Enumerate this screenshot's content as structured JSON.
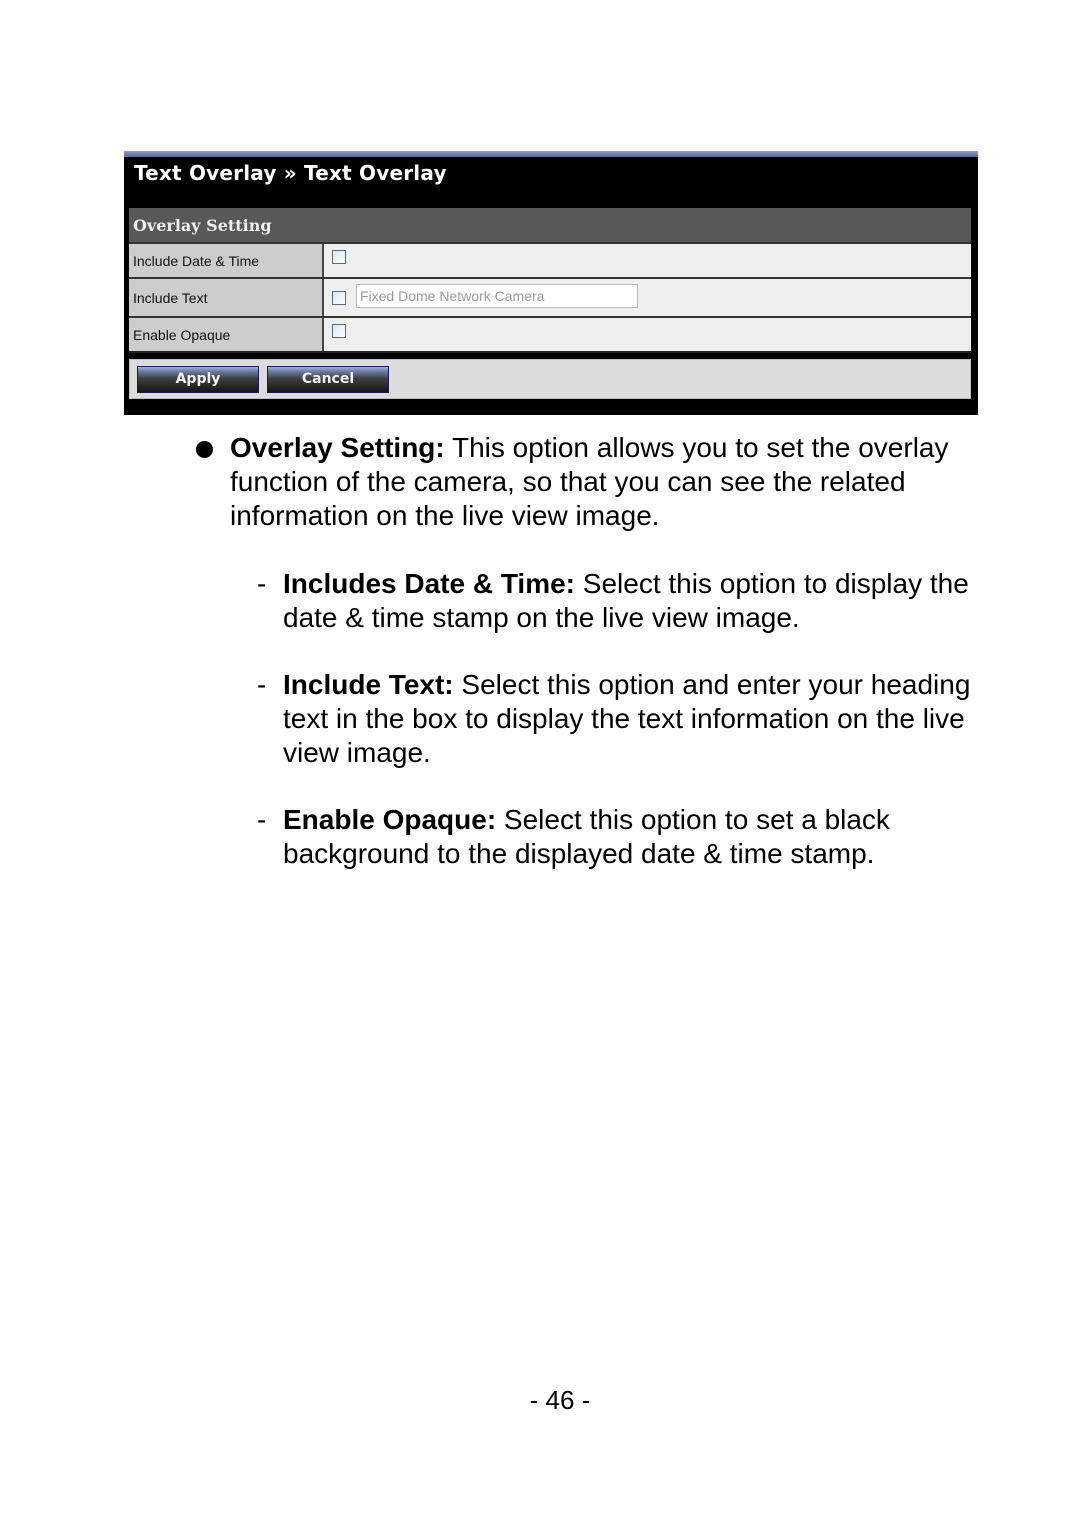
{
  "panel": {
    "title": "Text Overlay » Text Overlay",
    "section_title": "Overlay Setting",
    "rows": [
      {
        "label": "Include Date & Time",
        "checked": false
      },
      {
        "label": "Include Text",
        "checked": false,
        "input_value": "Fixed Dome Network Camera"
      },
      {
        "label": "Enable Opaque",
        "checked": false
      }
    ],
    "buttons": {
      "apply": "Apply",
      "cancel": "Cancel"
    }
  },
  "doc": {
    "bullet": {
      "term": "Overlay Setting:",
      "text": " This option allows you to set the overlay function of the camera, so that you can see the related information on the live view image."
    },
    "subitems": [
      {
        "dash": "-",
        "term": "Includes Date & Time:",
        "text": " Select this option to display the date & time stamp on the live view image."
      },
      {
        "dash": "-",
        "term": "Include Text:",
        "text": " Select this option and enter your heading text in the box to display the text information on the live view image."
      },
      {
        "dash": "-",
        "term": "Enable Opaque:",
        "text": " Select this option to set a black background to the displayed date & time stamp."
      }
    ],
    "page_number": "- 46 -"
  }
}
